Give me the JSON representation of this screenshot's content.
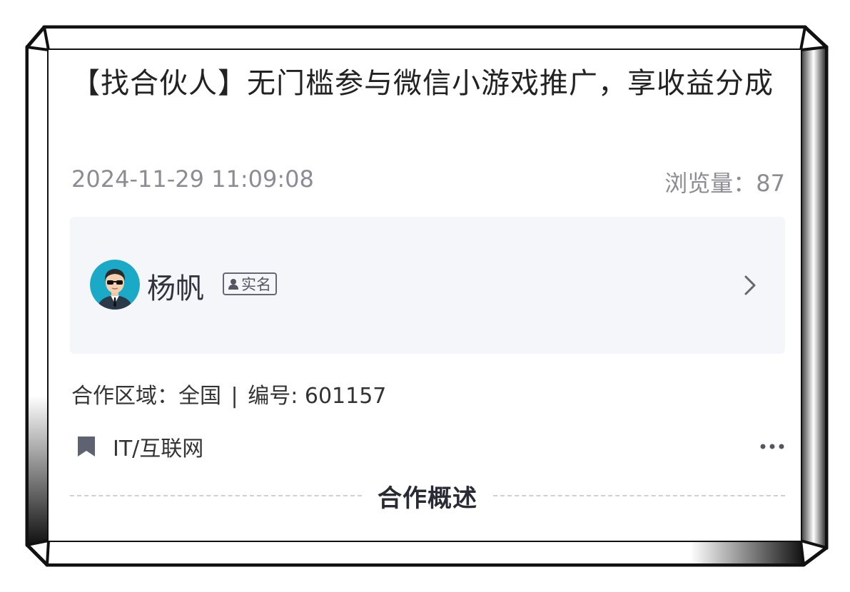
{
  "post": {
    "title": "【找合伙人】无门槛参与微信小游戏推广，享收益分成",
    "date": "2024-11-29 11:09:08",
    "views_label": "浏览量：",
    "views_count": "87"
  },
  "author": {
    "name": "杨帆",
    "badge": "实名",
    "avatar_icon": "avatar-man-sunglasses",
    "chevron_icon": "chevron-right-icon"
  },
  "details": {
    "region_label": "合作区域：",
    "region_value": "全国",
    "separator": "|",
    "number_label": "编号:",
    "number_value": "601157",
    "category": "IT/互联网",
    "category_icon": "bookmark-icon",
    "more_icon": "more-dots-icon"
  },
  "section": {
    "heading": "合作概述"
  },
  "colors": {
    "author_box_bg": "#f5f6fa",
    "meta_text": "#8c8c94",
    "avatar_bg": "#1aa9c6"
  }
}
